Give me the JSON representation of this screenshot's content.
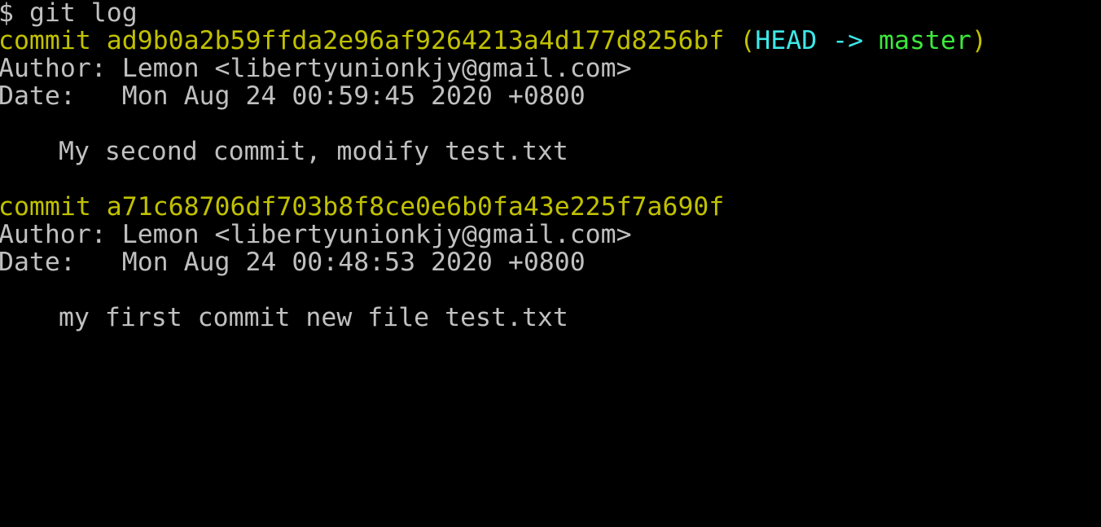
{
  "terminal": {
    "prompt": "$",
    "command": "git log",
    "commits": [
      {
        "commit_label": "commit",
        "hash": "ad9b0a2b59ffda2e96af9264213a4d177d8256bf",
        "ref_open": "(",
        "ref_head": "HEAD ->",
        "ref_branch": "master",
        "ref_close": ")",
        "author_label": "Author:",
        "author": "Lemon <libertyunionkjy@gmail.com>",
        "date_label": "Date:",
        "date": "Mon Aug 24 00:59:45 2020 +0800",
        "message": "My second commit, modify test.txt"
      },
      {
        "commit_label": "commit",
        "hash": "a71c68706df703b8f8ce0e6b0fa43e225f7a690f",
        "author_label": "Author:",
        "author": "Lemon <libertyunionkjy@gmail.com>",
        "date_label": "Date:",
        "date": "Mon Aug 24 00:48:53 2020 +0800",
        "message": "my first commit new file test.txt"
      }
    ]
  },
  "colors": {
    "background": "#000000",
    "text": "#c0c0c0",
    "commit": "#c1c100",
    "head": "#3ee8e8",
    "branch": "#3ce83c"
  }
}
